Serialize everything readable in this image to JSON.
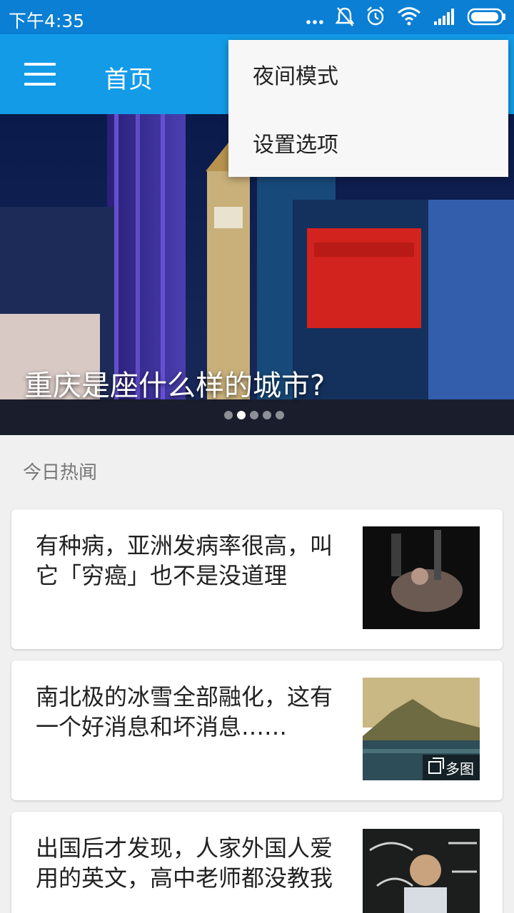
{
  "status_bar": {
    "time": "下午4:35",
    "icons": [
      "more-dots-icon",
      "bell-off-icon",
      "alarm-icon",
      "wifi-icon",
      "signal-icon",
      "battery-icon"
    ]
  },
  "app_bar": {
    "title": "首页",
    "color": "#139be8"
  },
  "menu": {
    "items": [
      {
        "label": "夜间模式"
      },
      {
        "label": "设置选项"
      }
    ]
  },
  "hero": {
    "headline": "重庆是座什么样的城市?",
    "dot_count": 5,
    "active_dot": 1
  },
  "section": {
    "title": "今日热闻"
  },
  "stories": [
    {
      "title": "有种病，亚洲发病率很高，叫它「穷癌」也不是没道理",
      "multi_image": false
    },
    {
      "title": "南北极的冰雪全部融化，这有一个好消息和坏消息……",
      "multi_image": true,
      "badge": "多图"
    },
    {
      "title": "出国后才发现，人家外国人爱用的英文，高中老师都没教我",
      "multi_image": false
    }
  ]
}
